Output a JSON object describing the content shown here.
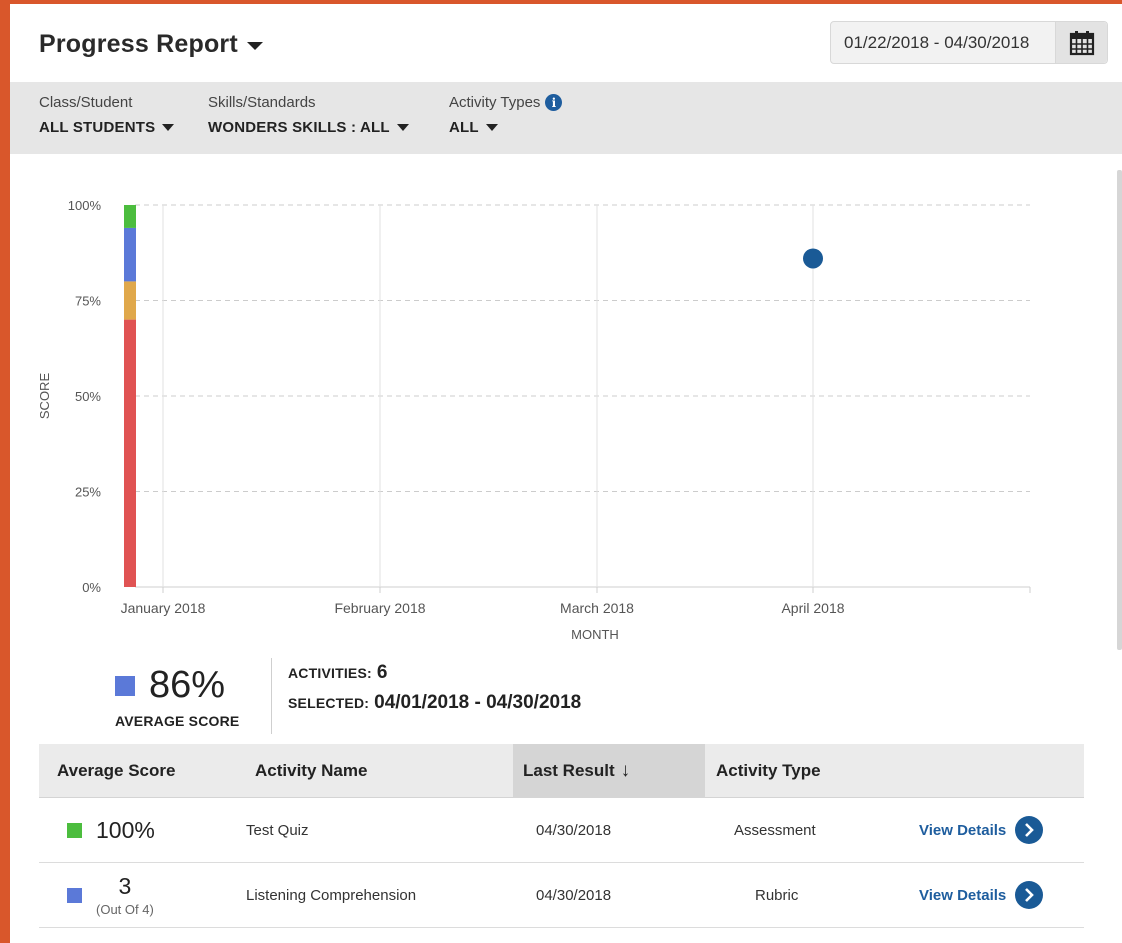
{
  "header": {
    "title": "Progress Report",
    "date_range": "01/22/2018 - 04/30/2018"
  },
  "filters": [
    {
      "label": "Class/Student",
      "value": "ALL STUDENTS"
    },
    {
      "label": "Skills/Standards",
      "value": "WONDERS SKILLS : ALL"
    },
    {
      "label": "Activity Types",
      "value": "ALL"
    }
  ],
  "chart_data": {
    "type": "scatter",
    "xlabel": "MONTH",
    "ylabel": "SCORE",
    "x_categories": [
      "January 2018",
      "February 2018",
      "March 2018",
      "April 2018"
    ],
    "y_ticks": [
      "0%",
      "25%",
      "50%",
      "75%",
      "100%"
    ],
    "ylim": [
      0,
      100
    ],
    "grid": true,
    "points": [
      {
        "x": "April 2018",
        "y": 86,
        "color": "#1a5a96"
      }
    ],
    "score_band_legend": [
      {
        "from": 0,
        "to": 70,
        "color": "#e05353"
      },
      {
        "from": 70,
        "to": 80,
        "color": "#e0a84b"
      },
      {
        "from": 80,
        "to": 94,
        "color": "#5b79d8"
      },
      {
        "from": 94,
        "to": 100,
        "color": "#4cbd3e"
      }
    ]
  },
  "summary": {
    "average_score": "86%",
    "average_label": "AVERAGE SCORE",
    "average_color": "#5b79d8",
    "activities_label": "ACTIVITIES:",
    "activities_value": "6",
    "selected_label": "SELECTED:",
    "selected_value": "04/01/2018 - 04/30/2018"
  },
  "table": {
    "headers": {
      "average_score": "Average Score",
      "activity_name": "Activity Name",
      "last_result": "Last Result",
      "activity_type": "Activity Type"
    },
    "rows": [
      {
        "score": "100%",
        "score_sub": "",
        "score_color": "#4cbd3e",
        "name": "Test Quiz",
        "last_result": "04/30/2018",
        "type": "Assessment",
        "action": "View Details"
      },
      {
        "score": "3",
        "score_sub": "(Out Of 4)",
        "score_color": "#5b79d8",
        "name": "Listening Comprehension",
        "last_result": "04/30/2018",
        "type": "Rubric",
        "action": "View Details"
      }
    ]
  }
}
